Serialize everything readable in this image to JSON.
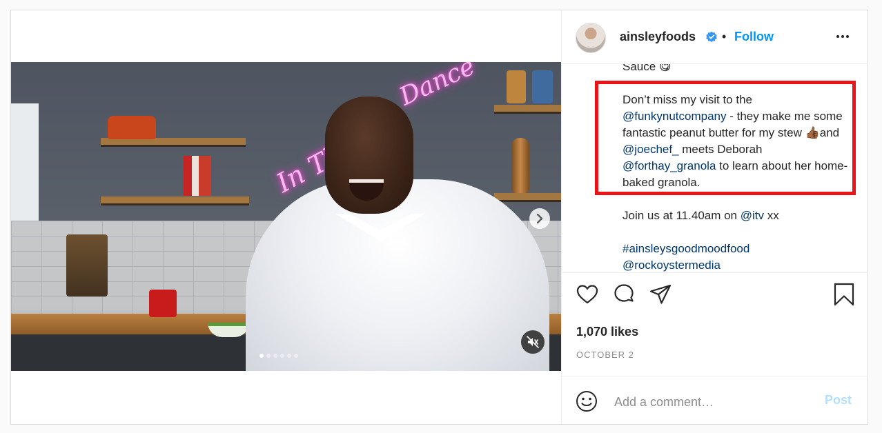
{
  "header": {
    "username": "ainsleyfoods",
    "separator": "•",
    "follow_label": "Follow"
  },
  "caption": {
    "top_line": "Sauce 😋",
    "highlight_text": [
      {
        "text": "Don’t miss my visit to the ",
        "mention": false
      },
      {
        "text": "@funkynutcompany",
        "mention": true
      },
      {
        "text": " - they make me some fantastic peanut butter for my stew 👍🏾and ",
        "mention": false
      },
      {
        "text": "@joechef_",
        "mention": true
      },
      {
        "text": " meets Deborah ",
        "mention": false
      },
      {
        "text": "@forthay_granola",
        "mention": true
      },
      {
        "text": " to learn about her home-baked granola.",
        "mention": false
      }
    ],
    "join_text": "Join us at 11.40am on ",
    "join_mention": "@itv",
    "join_suffix": " xx",
    "hashtag": "#ainsleysgoodmoodfood",
    "tag_mention": "@rockoystermedia"
  },
  "media": {
    "carousel_count": 6,
    "active_index": 0,
    "neon_text_1": "In This",
    "neon_text_2": "Dance"
  },
  "stats": {
    "likes": "1,070 likes",
    "date": "OCTOBER 2"
  },
  "comment_box": {
    "placeholder": "Add a comment…",
    "post_label": "Post"
  },
  "colors": {
    "link_blue": "#0095f6",
    "mention_navy": "#00376b",
    "highlight_red": "#e8141a",
    "post_disabled": "#b2dffc"
  },
  "icons": [
    "chevron-right-icon",
    "mute-icon",
    "verified-badge-icon",
    "more-options-icon",
    "heart-icon",
    "comment-icon",
    "share-icon",
    "bookmark-icon",
    "emoji-icon"
  ]
}
